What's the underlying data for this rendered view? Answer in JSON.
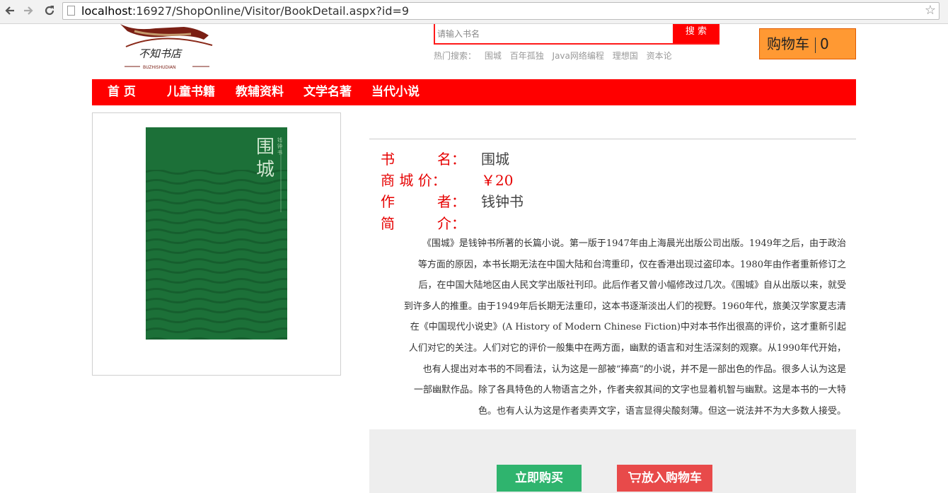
{
  "browser": {
    "url_host": "localhost",
    "url_rest": ":16927/ShopOnline/Visitor/BookDetail.aspx?id=9",
    "back_icon": "arrow-left-icon",
    "forward_icon": "arrow-right-icon",
    "reload_icon": "reload-icon",
    "star_icon": "star-icon"
  },
  "header": {
    "logo_text": "不知书店",
    "logo_sub": "BUZHISHUDIAN",
    "search_placeholder": "请输入书名",
    "search_button": "搜 索",
    "hot_label": "热门搜索：",
    "hot_items": [
      "围城",
      "百年孤独",
      "Java网络编程",
      "理想国",
      "资本论"
    ],
    "cart_label": "购物车",
    "cart_count": "0"
  },
  "nav": {
    "items": [
      "首 页",
      "儿童书籍",
      "教辅资料",
      "文学名著",
      "当代小说"
    ]
  },
  "book": {
    "cover_title": "围城",
    "cover_sub": "钱钟书",
    "labels": {
      "name": "书　　　名：",
      "price": "商 城 价：",
      "author": "作　　　者：",
      "intro": "简　　　介："
    },
    "name": "围城",
    "price": "￥20",
    "author": "钱钟书",
    "description": [
      "《围城》是钱钟书所著的长篇小说。第一版于1947年由上海晨光出版公司出版。1949年之后，由于政治",
      "等方面的原因，本书长期无法在中国大陆和台湾重印，仅在香港出现过盗印本。1980年由作者重新修订之",
      "后，在中国大陆地区由人民文学出版社刊印。此后作者又曾小幅修改过几次。《围城》自从出版以来，就受",
      "到许多人的推重。由于1949年后长期无法重印，这本书逐渐淡出人们的视野。1960年代，旅美汉学家夏志清",
      "在《中国现代小说史》(A History of Modern Chinese Fiction)中对本书作出很高的评价，这才重新引起",
      "人们对它的关注。人们对它的评价一般集中在两方面，幽默的语言和对生活深刻的观察。从1990年代开始，",
      "也有人提出对本书的不同看法，认为这是一部被“捧高”的小说，并不是一部出色的作品。很多人认为这是",
      "一部幽默作品。除了各具特色的人物语言之外，作者夹叙其间的文字也显着机智与幽默。这是本书的一大特",
      "色。也有人认为这是作者卖弄文字，语言显得尖酸刻薄。但这一说法并不为大多数人接受。"
    ]
  },
  "actions": {
    "buy_now": "立即购买",
    "add_to_cart": "放入购物车",
    "cart_icon": "shopping-cart-icon"
  }
}
